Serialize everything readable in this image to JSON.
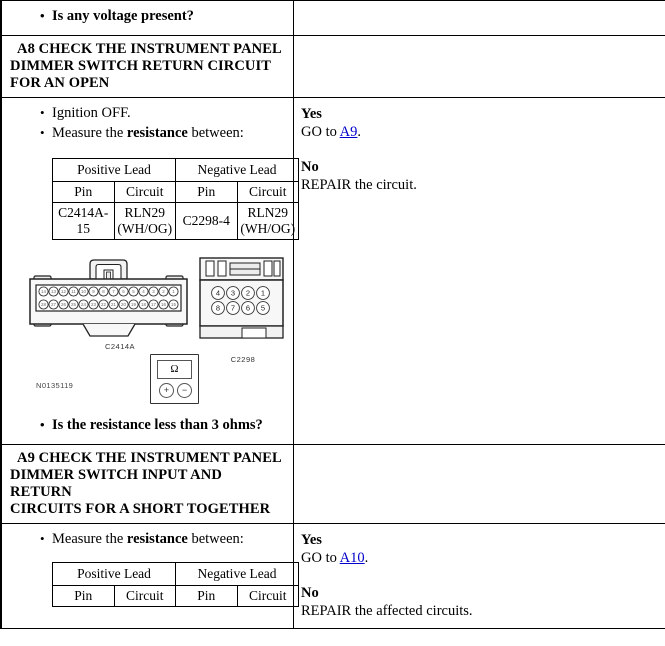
{
  "document": {
    "type": "pinpoint-test-procedure",
    "figure_id": "N0135119"
  },
  "rows": {
    "prev_question": "Is any voltage present?",
    "a8": {
      "header": "A8 CHECK THE INSTRUMENT PANEL DIMMER SWITCH RETURN CIRCUIT FOR AN OPEN",
      "header_lines": [
        "A8 CHECK THE INSTRUMENT PANEL",
        "DIMMER SWITCH RETURN CIRCUIT",
        "FOR AN OPEN"
      ],
      "steps": [
        {
          "text": "Ignition OFF.",
          "bold_part": ""
        },
        {
          "pre": "Measure the ",
          "bold": "resistance",
          "post": " between:"
        }
      ],
      "question": "Is the resistance less than 3 ohms?",
      "lead_table": {
        "group_headers": [
          "Positive Lead",
          "Negative Lead"
        ],
        "column_headers": [
          "Pin",
          "Circuit",
          "Pin",
          "Circuit"
        ],
        "rows": [
          [
            "C2414A-15",
            "RLN29 (WH/OG)",
            "C2298-4",
            "RLN29 (WH/OG)"
          ]
        ]
      },
      "answers": {
        "yes_label": "Yes",
        "yes_pre": "GO to ",
        "yes_link": "A9",
        "yes_post": ".",
        "no_label": "No",
        "no_text": "REPAIR the circuit."
      }
    },
    "a9": {
      "header": "A9 CHECK THE INSTRUMENT PANEL DIMMER SWITCH INPUT AND RETURN CIRCUITS FOR A SHORT TOGETHER",
      "header_lines": [
        "A9 CHECK THE INSTRUMENT PANEL",
        "DIMMER SWITCH INPUT AND RETURN",
        "CIRCUITS FOR A SHORT TOGETHER"
      ],
      "steps": [
        {
          "pre": "Measure the ",
          "bold": "resistance",
          "post": " between:"
        }
      ],
      "lead_table": {
        "group_headers": [
          "Positive Lead",
          "Negative Lead"
        ],
        "column_headers": [
          "Pin",
          "Circuit",
          "Pin",
          "Circuit"
        ]
      },
      "answers": {
        "yes_label": "Yes",
        "yes_pre": "GO to ",
        "yes_link": "A10",
        "yes_post": ".",
        "no_label": "No",
        "no_text": "REPAIR the affected circuits."
      }
    }
  },
  "figure": {
    "id": "N0135119",
    "connectors": [
      {
        "name": "C2414A",
        "label": "C2414A",
        "rows": 2,
        "pins_per_row": 14,
        "type": "multi-pin-rectangular-with-latch"
      },
      {
        "name": "C2298",
        "label": "C2298",
        "rows": 2,
        "pins_per_row": 4,
        "pin_numbers_top": [
          "4",
          "3",
          "2",
          "1"
        ],
        "pin_numbers_bottom": [
          "8",
          "7",
          "6",
          "5"
        ],
        "type": "eight-pin-rectangular"
      }
    ],
    "meter": {
      "type": "ohmmeter",
      "display": "Ω",
      "terminals": [
        "+",
        "−"
      ]
    }
  },
  "colors": {
    "link": "#0000cc",
    "border": "#000000",
    "background": "#ffffff"
  }
}
